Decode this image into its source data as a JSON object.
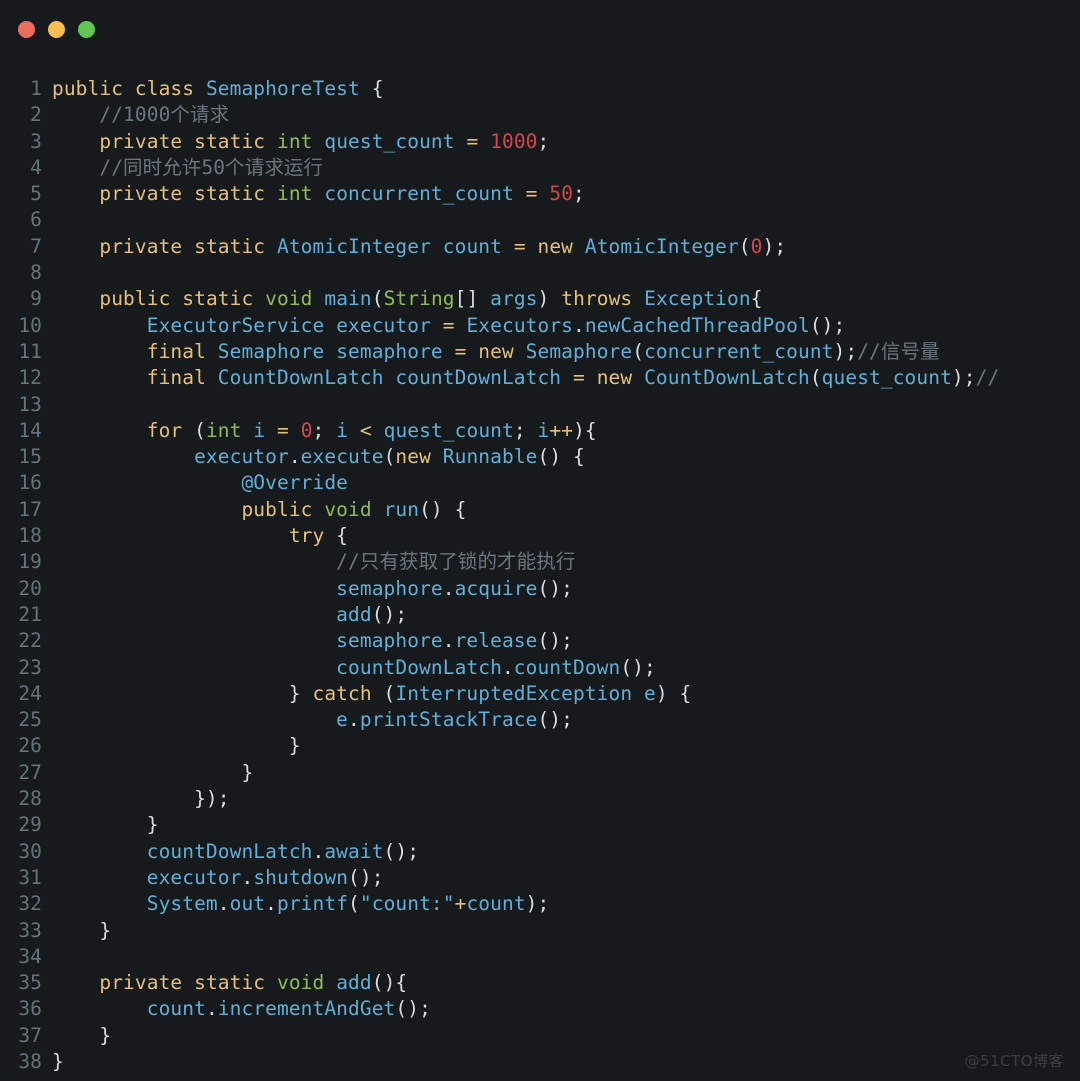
{
  "window": {
    "background_color": "#171a1c",
    "controls": [
      {
        "name": "close",
        "color": "#ed6a5e",
        "label": "Close"
      },
      {
        "name": "minimize",
        "color": "#f5be4f",
        "label": "Minimize"
      },
      {
        "name": "maximize",
        "color": "#61c554",
        "label": "Maximize"
      }
    ]
  },
  "theme": {
    "line_number_color": "#62737d",
    "keyword_color": "#e6c07a",
    "type_color": "#8fbc5a",
    "identifier_color": "#61afd8",
    "number_color": "#d2484a",
    "comment_color": "#6a7580",
    "plain_color": "#d8dee4"
  },
  "watermark": {
    "text": "@51CTO博客"
  },
  "editor": {
    "language": "java",
    "class_name": "SemaphoreTest",
    "first_line": 1,
    "last_line": 38,
    "lines": [
      {
        "n": "1",
        "tokens": [
          {
            "t": "public",
            "c": "kw"
          },
          {
            "t": " ",
            "c": "pl"
          },
          {
            "t": "class",
            "c": "kw"
          },
          {
            "t": " ",
            "c": "pl"
          },
          {
            "t": "SemaphoreTest",
            "c": "id"
          },
          {
            "t": " {",
            "c": "pl"
          }
        ]
      },
      {
        "n": "2",
        "tokens": [
          {
            "t": "    ",
            "c": "pl"
          },
          {
            "t": "//1000个请求",
            "c": "cmt"
          }
        ]
      },
      {
        "n": "3",
        "tokens": [
          {
            "t": "    ",
            "c": "pl"
          },
          {
            "t": "private",
            "c": "kw"
          },
          {
            "t": " ",
            "c": "pl"
          },
          {
            "t": "static",
            "c": "kw"
          },
          {
            "t": " ",
            "c": "pl"
          },
          {
            "t": "int",
            "c": "typ"
          },
          {
            "t": " ",
            "c": "pl"
          },
          {
            "t": "quest_count",
            "c": "id"
          },
          {
            "t": " ",
            "c": "pl"
          },
          {
            "t": "=",
            "c": "op"
          },
          {
            "t": " ",
            "c": "pl"
          },
          {
            "t": "1000",
            "c": "num"
          },
          {
            "t": ";",
            "c": "pl"
          }
        ]
      },
      {
        "n": "4",
        "tokens": [
          {
            "t": "    ",
            "c": "pl"
          },
          {
            "t": "//同时允许50个请求运行",
            "c": "cmt"
          }
        ]
      },
      {
        "n": "5",
        "tokens": [
          {
            "t": "    ",
            "c": "pl"
          },
          {
            "t": "private",
            "c": "kw"
          },
          {
            "t": " ",
            "c": "pl"
          },
          {
            "t": "static",
            "c": "kw"
          },
          {
            "t": " ",
            "c": "pl"
          },
          {
            "t": "int",
            "c": "typ"
          },
          {
            "t": " ",
            "c": "pl"
          },
          {
            "t": "concurrent_count",
            "c": "id"
          },
          {
            "t": " ",
            "c": "pl"
          },
          {
            "t": "=",
            "c": "op"
          },
          {
            "t": " ",
            "c": "pl"
          },
          {
            "t": "50",
            "c": "num"
          },
          {
            "t": ";",
            "c": "pl"
          }
        ]
      },
      {
        "n": "6",
        "tokens": []
      },
      {
        "n": "7",
        "tokens": [
          {
            "t": "    ",
            "c": "pl"
          },
          {
            "t": "private",
            "c": "kw"
          },
          {
            "t": " ",
            "c": "pl"
          },
          {
            "t": "static",
            "c": "kw"
          },
          {
            "t": " ",
            "c": "pl"
          },
          {
            "t": "AtomicInteger",
            "c": "id"
          },
          {
            "t": " ",
            "c": "pl"
          },
          {
            "t": "count",
            "c": "id"
          },
          {
            "t": " ",
            "c": "pl"
          },
          {
            "t": "=",
            "c": "op"
          },
          {
            "t": " ",
            "c": "pl"
          },
          {
            "t": "new",
            "c": "kw"
          },
          {
            "t": " ",
            "c": "pl"
          },
          {
            "t": "AtomicInteger",
            "c": "id"
          },
          {
            "t": "(",
            "c": "pl"
          },
          {
            "t": "0",
            "c": "num"
          },
          {
            "t": ");",
            "c": "pl"
          }
        ]
      },
      {
        "n": "8",
        "tokens": []
      },
      {
        "n": "9",
        "tokens": [
          {
            "t": "    ",
            "c": "pl"
          },
          {
            "t": "public",
            "c": "kw"
          },
          {
            "t": " ",
            "c": "pl"
          },
          {
            "t": "static",
            "c": "kw"
          },
          {
            "t": " ",
            "c": "pl"
          },
          {
            "t": "void",
            "c": "typ"
          },
          {
            "t": " ",
            "c": "pl"
          },
          {
            "t": "main",
            "c": "id"
          },
          {
            "t": "(",
            "c": "pl"
          },
          {
            "t": "String",
            "c": "typ"
          },
          {
            "t": "[] ",
            "c": "pl"
          },
          {
            "t": "args",
            "c": "id"
          },
          {
            "t": ") ",
            "c": "pl"
          },
          {
            "t": "throws",
            "c": "kw"
          },
          {
            "t": " ",
            "c": "pl"
          },
          {
            "t": "Exception",
            "c": "id"
          },
          {
            "t": "{",
            "c": "pl"
          }
        ]
      },
      {
        "n": "10",
        "tokens": [
          {
            "t": "        ",
            "c": "pl"
          },
          {
            "t": "ExecutorService",
            "c": "id"
          },
          {
            "t": " ",
            "c": "pl"
          },
          {
            "t": "executor",
            "c": "id"
          },
          {
            "t": " ",
            "c": "pl"
          },
          {
            "t": "=",
            "c": "op"
          },
          {
            "t": " ",
            "c": "pl"
          },
          {
            "t": "Executors",
            "c": "id"
          },
          {
            "t": ".",
            "c": "pl"
          },
          {
            "t": "newCachedThreadPool",
            "c": "id"
          },
          {
            "t": "();",
            "c": "pl"
          }
        ]
      },
      {
        "n": "11",
        "tokens": [
          {
            "t": "        ",
            "c": "pl"
          },
          {
            "t": "final",
            "c": "kw"
          },
          {
            "t": " ",
            "c": "pl"
          },
          {
            "t": "Semaphore",
            "c": "id"
          },
          {
            "t": " ",
            "c": "pl"
          },
          {
            "t": "semaphore",
            "c": "id"
          },
          {
            "t": " ",
            "c": "pl"
          },
          {
            "t": "=",
            "c": "op"
          },
          {
            "t": " ",
            "c": "pl"
          },
          {
            "t": "new",
            "c": "kw"
          },
          {
            "t": " ",
            "c": "pl"
          },
          {
            "t": "Semaphore",
            "c": "id"
          },
          {
            "t": "(",
            "c": "pl"
          },
          {
            "t": "concurrent_count",
            "c": "id"
          },
          {
            "t": ");",
            "c": "pl"
          },
          {
            "t": "//信号量",
            "c": "cmt"
          }
        ]
      },
      {
        "n": "12",
        "tokens": [
          {
            "t": "        ",
            "c": "pl"
          },
          {
            "t": "final",
            "c": "kw"
          },
          {
            "t": " ",
            "c": "pl"
          },
          {
            "t": "CountDownLatch",
            "c": "id"
          },
          {
            "t": " ",
            "c": "pl"
          },
          {
            "t": "countDownLatch",
            "c": "id"
          },
          {
            "t": " ",
            "c": "pl"
          },
          {
            "t": "=",
            "c": "op"
          },
          {
            "t": " ",
            "c": "pl"
          },
          {
            "t": "new",
            "c": "kw"
          },
          {
            "t": " ",
            "c": "pl"
          },
          {
            "t": "CountDownLatch",
            "c": "id"
          },
          {
            "t": "(",
            "c": "pl"
          },
          {
            "t": "quest_count",
            "c": "id"
          },
          {
            "t": ");",
            "c": "pl"
          },
          {
            "t": "//",
            "c": "cmt"
          }
        ]
      },
      {
        "n": "13",
        "tokens": []
      },
      {
        "n": "14",
        "tokens": [
          {
            "t": "        ",
            "c": "pl"
          },
          {
            "t": "for",
            "c": "kw"
          },
          {
            "t": " (",
            "c": "pl"
          },
          {
            "t": "int",
            "c": "typ"
          },
          {
            "t": " ",
            "c": "pl"
          },
          {
            "t": "i",
            "c": "id"
          },
          {
            "t": " ",
            "c": "pl"
          },
          {
            "t": "=",
            "c": "op"
          },
          {
            "t": " ",
            "c": "pl"
          },
          {
            "t": "0",
            "c": "num"
          },
          {
            "t": "; ",
            "c": "pl"
          },
          {
            "t": "i",
            "c": "id"
          },
          {
            "t": " ",
            "c": "pl"
          },
          {
            "t": "<",
            "c": "op"
          },
          {
            "t": " ",
            "c": "pl"
          },
          {
            "t": "quest_count",
            "c": "id"
          },
          {
            "t": "; ",
            "c": "pl"
          },
          {
            "t": "i",
            "c": "id"
          },
          {
            "t": "++",
            "c": "op"
          },
          {
            "t": "){",
            "c": "pl"
          }
        ]
      },
      {
        "n": "15",
        "tokens": [
          {
            "t": "            ",
            "c": "pl"
          },
          {
            "t": "executor",
            "c": "id"
          },
          {
            "t": ".",
            "c": "pl"
          },
          {
            "t": "execute",
            "c": "id"
          },
          {
            "t": "(",
            "c": "pl"
          },
          {
            "t": "new",
            "c": "kw"
          },
          {
            "t": " ",
            "c": "pl"
          },
          {
            "t": "Runnable",
            "c": "id"
          },
          {
            "t": "() {",
            "c": "pl"
          }
        ]
      },
      {
        "n": "16",
        "tokens": [
          {
            "t": "                ",
            "c": "pl"
          },
          {
            "t": "@Override",
            "c": "ann"
          }
        ]
      },
      {
        "n": "17",
        "tokens": [
          {
            "t": "                ",
            "c": "pl"
          },
          {
            "t": "public",
            "c": "kw"
          },
          {
            "t": " ",
            "c": "pl"
          },
          {
            "t": "void",
            "c": "typ"
          },
          {
            "t": " ",
            "c": "pl"
          },
          {
            "t": "run",
            "c": "id"
          },
          {
            "t": "() {",
            "c": "pl"
          }
        ]
      },
      {
        "n": "18",
        "tokens": [
          {
            "t": "                    ",
            "c": "pl"
          },
          {
            "t": "try",
            "c": "kw"
          },
          {
            "t": " {",
            "c": "pl"
          }
        ]
      },
      {
        "n": "19",
        "tokens": [
          {
            "t": "                        ",
            "c": "pl"
          },
          {
            "t": "//只有获取了锁的才能执行",
            "c": "cmt"
          }
        ]
      },
      {
        "n": "20",
        "tokens": [
          {
            "t": "                        ",
            "c": "pl"
          },
          {
            "t": "semaphore",
            "c": "id"
          },
          {
            "t": ".",
            "c": "pl"
          },
          {
            "t": "acquire",
            "c": "id"
          },
          {
            "t": "();",
            "c": "pl"
          }
        ]
      },
      {
        "n": "21",
        "tokens": [
          {
            "t": "                        ",
            "c": "pl"
          },
          {
            "t": "add",
            "c": "id"
          },
          {
            "t": "();",
            "c": "pl"
          }
        ]
      },
      {
        "n": "22",
        "tokens": [
          {
            "t": "                        ",
            "c": "pl"
          },
          {
            "t": "semaphore",
            "c": "id"
          },
          {
            "t": ".",
            "c": "pl"
          },
          {
            "t": "release",
            "c": "id"
          },
          {
            "t": "();",
            "c": "pl"
          }
        ]
      },
      {
        "n": "23",
        "tokens": [
          {
            "t": "                        ",
            "c": "pl"
          },
          {
            "t": "countDownLatch",
            "c": "id"
          },
          {
            "t": ".",
            "c": "pl"
          },
          {
            "t": "countDown",
            "c": "id"
          },
          {
            "t": "();",
            "c": "pl"
          }
        ]
      },
      {
        "n": "24",
        "tokens": [
          {
            "t": "                    } ",
            "c": "pl"
          },
          {
            "t": "catch",
            "c": "kw"
          },
          {
            "t": " (",
            "c": "pl"
          },
          {
            "t": "InterruptedException",
            "c": "id"
          },
          {
            "t": " ",
            "c": "pl"
          },
          {
            "t": "e",
            "c": "id"
          },
          {
            "t": ") {",
            "c": "pl"
          }
        ]
      },
      {
        "n": "25",
        "tokens": [
          {
            "t": "                        ",
            "c": "pl"
          },
          {
            "t": "e",
            "c": "id"
          },
          {
            "t": ".",
            "c": "pl"
          },
          {
            "t": "printStackTrace",
            "c": "id"
          },
          {
            "t": "();",
            "c": "pl"
          }
        ]
      },
      {
        "n": "26",
        "tokens": [
          {
            "t": "                    }",
            "c": "pl"
          }
        ]
      },
      {
        "n": "27",
        "tokens": [
          {
            "t": "                }",
            "c": "pl"
          }
        ]
      },
      {
        "n": "28",
        "tokens": [
          {
            "t": "            });",
            "c": "pl"
          }
        ]
      },
      {
        "n": "29",
        "tokens": [
          {
            "t": "        }",
            "c": "pl"
          }
        ]
      },
      {
        "n": "30",
        "tokens": [
          {
            "t": "        ",
            "c": "pl"
          },
          {
            "t": "countDownLatch",
            "c": "id"
          },
          {
            "t": ".",
            "c": "pl"
          },
          {
            "t": "await",
            "c": "id"
          },
          {
            "t": "();",
            "c": "pl"
          }
        ]
      },
      {
        "n": "31",
        "tokens": [
          {
            "t": "        ",
            "c": "pl"
          },
          {
            "t": "executor",
            "c": "id"
          },
          {
            "t": ".",
            "c": "pl"
          },
          {
            "t": "shutdown",
            "c": "id"
          },
          {
            "t": "();",
            "c": "pl"
          }
        ]
      },
      {
        "n": "32",
        "tokens": [
          {
            "t": "        ",
            "c": "pl"
          },
          {
            "t": "System",
            "c": "id"
          },
          {
            "t": ".",
            "c": "pl"
          },
          {
            "t": "out",
            "c": "id"
          },
          {
            "t": ".",
            "c": "pl"
          },
          {
            "t": "printf",
            "c": "id"
          },
          {
            "t": "(",
            "c": "pl"
          },
          {
            "t": "\"count:\"",
            "c": "str"
          },
          {
            "t": "+",
            "c": "op"
          },
          {
            "t": "count",
            "c": "id"
          },
          {
            "t": ");",
            "c": "pl"
          }
        ]
      },
      {
        "n": "33",
        "tokens": [
          {
            "t": "    }",
            "c": "pl"
          }
        ]
      },
      {
        "n": "34",
        "tokens": []
      },
      {
        "n": "35",
        "tokens": [
          {
            "t": "    ",
            "c": "pl"
          },
          {
            "t": "private",
            "c": "kw"
          },
          {
            "t": " ",
            "c": "pl"
          },
          {
            "t": "static",
            "c": "kw"
          },
          {
            "t": " ",
            "c": "pl"
          },
          {
            "t": "void",
            "c": "typ"
          },
          {
            "t": " ",
            "c": "pl"
          },
          {
            "t": "add",
            "c": "id"
          },
          {
            "t": "(){",
            "c": "pl"
          }
        ]
      },
      {
        "n": "36",
        "tokens": [
          {
            "t": "        ",
            "c": "pl"
          },
          {
            "t": "count",
            "c": "id"
          },
          {
            "t": ".",
            "c": "pl"
          },
          {
            "t": "incrementAndGet",
            "c": "id"
          },
          {
            "t": "();",
            "c": "pl"
          }
        ]
      },
      {
        "n": "37",
        "tokens": [
          {
            "t": "    }",
            "c": "pl"
          }
        ]
      },
      {
        "n": "38",
        "tokens": [
          {
            "t": "}",
            "c": "pl"
          }
        ]
      }
    ]
  }
}
